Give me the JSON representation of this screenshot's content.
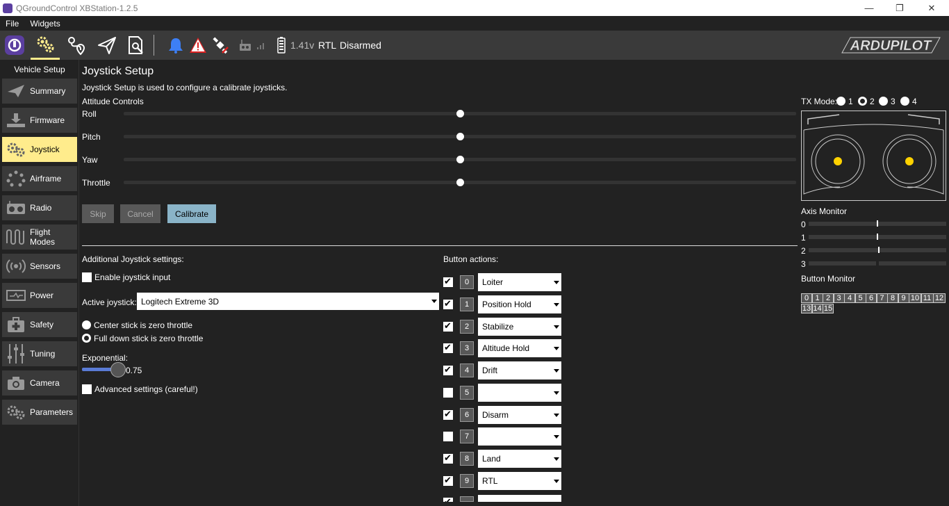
{
  "window": {
    "title": "QGroundControl  XBStation-1.2.5",
    "minimize": "—",
    "restore": "❐",
    "close": "✕"
  },
  "menu": [
    "File",
    "Widgets"
  ],
  "toolbar": {
    "voltage": "1.41v",
    "flight_mode": "RTL",
    "arm_state": "Disarmed",
    "logo": "ARDUPILOT",
    "icons": [
      "qgc-logo-icon",
      "settings-gears-icon",
      "plan-waypoint-icon",
      "fly-paper-plane-icon",
      "analyze-doc-icon",
      "bell-icon",
      "warning-icon",
      "gps-icon",
      "rc-transmitter-icon",
      "signal-bars-icon",
      "battery-icon"
    ],
    "colors": {
      "active_underline": "#ffec8c",
      "bell": "#3d7ff5",
      "warning": "#e02020"
    }
  },
  "sidebar": {
    "title": "Vehicle Setup",
    "items": [
      {
        "label": "Summary",
        "icon": "paper-plane-icon"
      },
      {
        "label": "Firmware",
        "icon": "download-icon"
      },
      {
        "label": "Joystick",
        "icon": "joystick-gears-icon",
        "active": true
      },
      {
        "label": "Airframe",
        "icon": "airframe-dots-icon"
      },
      {
        "label": "Radio",
        "icon": "radio-icon"
      },
      {
        "label": "Flight Modes",
        "icon": "flight-modes-wave-icon"
      },
      {
        "label": "Sensors",
        "icon": "sensors-broadcast-icon"
      },
      {
        "label": "Power",
        "icon": "power-icon"
      },
      {
        "label": "Safety",
        "icon": "safety-plus-icon"
      },
      {
        "label": "Tuning",
        "icon": "tuning-sliders-icon"
      },
      {
        "label": "Camera",
        "icon": "camera-icon"
      },
      {
        "label": "Parameters",
        "icon": "parameters-gears-icon"
      }
    ]
  },
  "main": {
    "title": "Joystick Setup",
    "description": "Joystick Setup is used to configure a calibrate joysticks.",
    "attitude_label": "Attitude Controls",
    "attitude": [
      {
        "label": "Roll",
        "value": 0.5
      },
      {
        "label": "Pitch",
        "value": 0.5
      },
      {
        "label": "Yaw",
        "value": 0.5
      },
      {
        "label": "Throttle",
        "value": 0.5
      }
    ],
    "buttons": {
      "skip": "Skip",
      "cancel": "Cancel",
      "calibrate": "Calibrate"
    },
    "tx_mode": {
      "label": "TX Mode:",
      "options": [
        "1",
        "2",
        "3",
        "4"
      ],
      "selected": "2"
    },
    "axis_monitor": {
      "label": "Axis Monitor",
      "axes": [
        {
          "id": "0",
          "value": 0.5
        },
        {
          "id": "1",
          "value": 0.5
        },
        {
          "id": "2",
          "value": 0.51
        },
        {
          "id": "3",
          "value": null
        }
      ]
    },
    "button_monitor": {
      "label": "Button Monitor",
      "buttons": [
        "0",
        "1",
        "2",
        "3",
        "4",
        "5",
        "6",
        "7",
        "8",
        "9",
        "10",
        "11",
        "12",
        "13",
        "14",
        "15"
      ]
    },
    "additional": {
      "label": "Additional Joystick settings:",
      "enable_label": "Enable joystick input",
      "enable_checked": false,
      "active_label": "Active joystick:",
      "active_value": "Logitech Extreme 3D",
      "throttle_options": [
        {
          "label": "Center stick is zero throttle",
          "checked": false
        },
        {
          "label": "Full down stick is zero throttle",
          "checked": true
        }
      ],
      "exponential_label": "Exponential:",
      "exponential_value": "0.75",
      "advanced_label": "Advanced settings (careful!)",
      "advanced_checked": false
    },
    "button_actions": {
      "label": "Button actions:",
      "rows": [
        {
          "num": "0",
          "checked": true,
          "action": "Loiter"
        },
        {
          "num": "1",
          "checked": true,
          "action": "Position Hold"
        },
        {
          "num": "2",
          "checked": true,
          "action": "Stabilize"
        },
        {
          "num": "3",
          "checked": true,
          "action": "Altitude Hold"
        },
        {
          "num": "4",
          "checked": true,
          "action": "Drift"
        },
        {
          "num": "5",
          "checked": false,
          "action": ""
        },
        {
          "num": "6",
          "checked": true,
          "action": "Disarm"
        },
        {
          "num": "7",
          "checked": false,
          "action": ""
        },
        {
          "num": "8",
          "checked": true,
          "action": "Land"
        },
        {
          "num": "9",
          "checked": true,
          "action": "RTL"
        }
      ]
    }
  }
}
